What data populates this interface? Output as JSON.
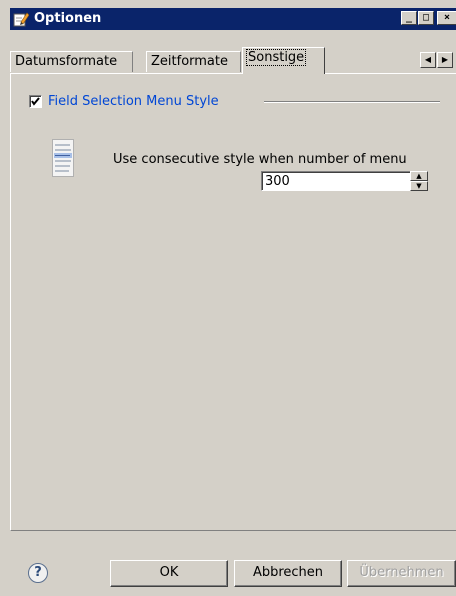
{
  "window": {
    "title": "Optionen"
  },
  "title_buttons": {
    "minimize": "_",
    "maximize": "□",
    "close": "×"
  },
  "tabs": [
    {
      "label": "Datumsformate",
      "active": false
    },
    {
      "label": "Zeitformate",
      "active": false
    },
    {
      "label": "Sonstige",
      "active": true
    }
  ],
  "tab_scroll": {
    "left": "◀",
    "right": "▶"
  },
  "group": {
    "label": "Field Selection Menu Style",
    "checked": true
  },
  "setting": {
    "description": "Use consecutive style when number of menu",
    "value": "300"
  },
  "buttons": {
    "help": "?",
    "ok": "OK",
    "cancel": "Abbrechen",
    "apply": "Übernehmen"
  },
  "colors": {
    "titlebar": "#0a246a",
    "group_label": "#0046d5",
    "face": "#d4d0c8"
  }
}
